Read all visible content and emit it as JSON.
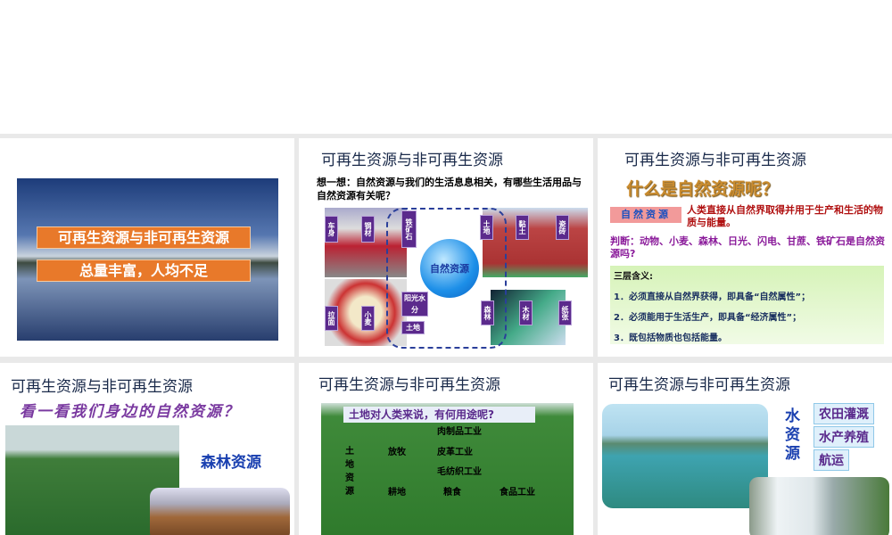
{
  "slides": [
    {
      "title": "可再生资源与非可再生资源",
      "subtitle": "总量丰富，人均不足"
    },
    {
      "title": "可再生资源与非可再生资源",
      "question": "想一想：自然资源与我们的生活息息相关，有哪些生活用品与自然资源有关呢？",
      "center": "自然资源",
      "labels": {
        "chesheng": "车身",
        "gangcai": "钢材",
        "tiekuangshi": "铁矿石",
        "tudi1": "土地",
        "niantu": "黏土",
        "zhuan": "瓷砖",
        "lamian": "拉面",
        "xiaomai": "小麦",
        "yangguang": "阳光水分",
        "tudi2": "土地",
        "senlin": "森林",
        "mucai": "木材",
        "zhizhang": "纸张"
      }
    },
    {
      "title": "可再生资源与非可再生资源",
      "question": "什么是自然资源呢？",
      "term": "自然资源",
      "definition": "人类直接从自然界取得并用于生产和生活的物质与能量。",
      "judge": "判断：动物、小麦、森林、日光、闪电、甘蔗、铁矿石是自然资源吗?",
      "meaning_title": "三层含义:",
      "meanings": [
        "1．必须直接从自然界获得，即具备“自然属性”；",
        "2．必须能用于生活生产，即具备“经济属性”；",
        "3．既包括物质也包括能量。"
      ]
    },
    {
      "title": "可再生资源与非可再生资源",
      "question": "看一看我们身边的自然资源？",
      "label": "森林资源"
    },
    {
      "title": "可再生资源与非可再生资源",
      "question": "土地对人类来说，有何用途呢?",
      "root": "土地资源",
      "branch1": "放牧",
      "branch2": "耕地",
      "leaves": [
        "肉制品工业",
        "皮革工业",
        "毛纺织工业"
      ],
      "grain": "粮食",
      "food": "食品工业"
    },
    {
      "title": "可再生资源与非可再生资源",
      "root": "水资源",
      "uses": [
        "农田灌溉",
        "水产养殖",
        "航运"
      ]
    }
  ]
}
